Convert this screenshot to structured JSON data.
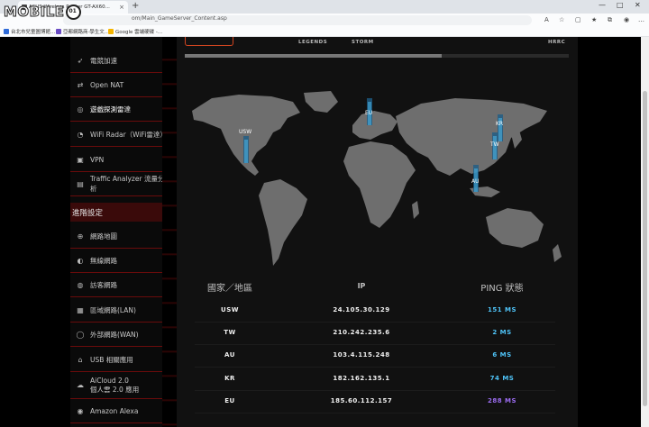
{
  "browser": {
    "tab_title": "ASUS Wireless Router GT-AX60...",
    "url": "om/Main_GameServer_Content.asp",
    "favorites": [
      {
        "label": "台北市兒童圖博館...",
        "color": "#2f6bd8"
      },
      {
        "label": "亞都網路商·學生文...",
        "color": "#6a4cc4"
      },
      {
        "label": "Google 雲端硬碟 -...",
        "color": "#f4b400"
      }
    ]
  },
  "logo": {
    "text": "MOBILE"
  },
  "top_tabs": [
    "LEGENDS",
    "STORM",
    "HRRC"
  ],
  "progress": 0.67,
  "sidebar": {
    "items_top": [
      {
        "label": "電競加速",
        "icon": "rocket-icon"
      },
      {
        "label": "Open NAT",
        "icon": "nat-icon"
      },
      {
        "label": "遊戲探測雷達",
        "icon": "radar-icon"
      },
      {
        "label": "WiFi Radar（WiFi雷達）",
        "icon": "wifi-icon"
      },
      {
        "label": "VPN",
        "icon": "vpn-icon"
      },
      {
        "label": "Traffic Analyzer 流量分析",
        "icon": "chart-icon"
      }
    ],
    "section": "進階設定",
    "items_advanced": [
      {
        "label": "網路地圖",
        "icon": "globe-icon"
      },
      {
        "label": "無線網路",
        "icon": "wireless-icon"
      },
      {
        "label": "訪客網路",
        "icon": "guest-icon"
      },
      {
        "label": "區域網路(LAN)",
        "icon": "lan-icon"
      },
      {
        "label": "外部網路(WAN)",
        "icon": "wan-icon"
      },
      {
        "label": "USB 相關應用",
        "icon": "usb-icon"
      },
      {
        "label": "AiCloud 2.0\n個人雲 2.0 應用",
        "icon": "cloud-icon"
      },
      {
        "label": "Amazon Alexa",
        "icon": "alexa-icon"
      }
    ]
  },
  "map_markers": [
    {
      "label": "USW"
    },
    {
      "label": "EU"
    },
    {
      "label": "KR"
    },
    {
      "label": "TW"
    },
    {
      "label": "AU"
    }
  ],
  "table": {
    "headers": [
      "國家／地區",
      "IP",
      "PING 狀態"
    ],
    "rows": [
      {
        "region": "USW",
        "ip": "24.105.30.129",
        "ping": "151 MS",
        "color": "#4fc3f7"
      },
      {
        "region": "TW",
        "ip": "210.242.235.6",
        "ping": "2 MS",
        "color": "#4fc3f7"
      },
      {
        "region": "AU",
        "ip": "103.4.115.248",
        "ping": "6 MS",
        "color": "#4fc3f7"
      },
      {
        "region": "KR",
        "ip": "182.162.135.1",
        "ping": "74 MS",
        "color": "#4fc3f7"
      },
      {
        "region": "EU",
        "ip": "185.60.112.157",
        "ping": "288 MS",
        "color": "#9b6cf0"
      }
    ]
  }
}
